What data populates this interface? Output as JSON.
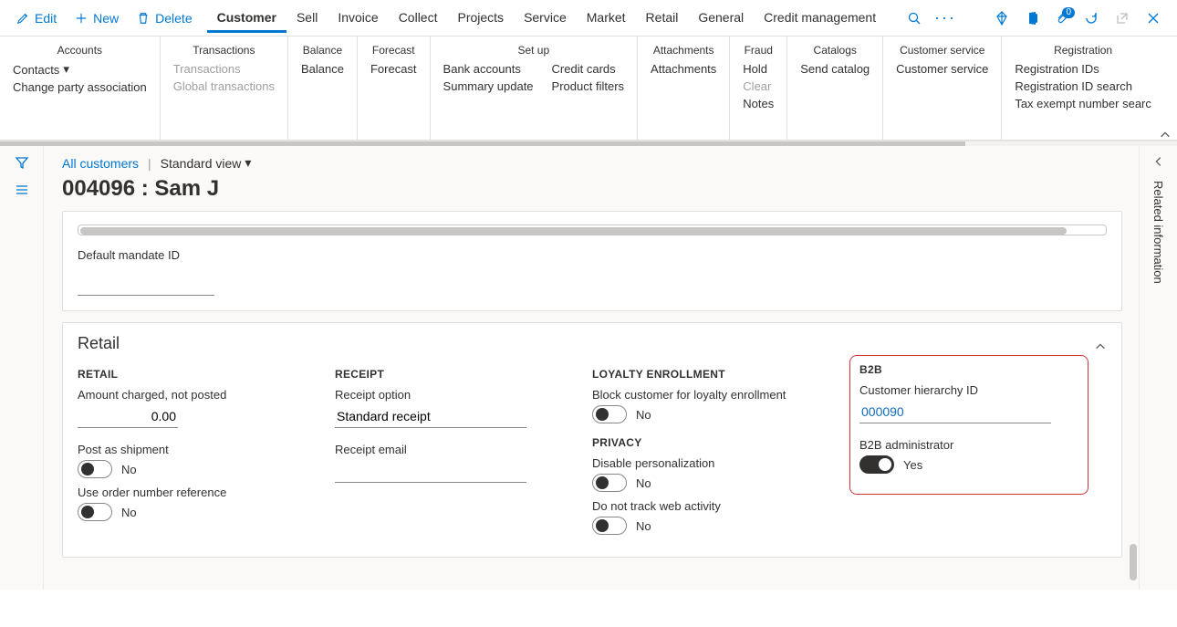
{
  "topbar": {
    "edit": "Edit",
    "new": "New",
    "delete": "Delete",
    "tabs": [
      "Customer",
      "Sell",
      "Invoice",
      "Collect",
      "Projects",
      "Service",
      "Market",
      "Retail",
      "General",
      "Credit management"
    ],
    "active_tab_index": 0,
    "notifications_count": "0"
  },
  "ribbon": {
    "groups": [
      {
        "title": "Accounts",
        "cols": [
          [
            "Contacts",
            "Change party association"
          ]
        ]
      },
      {
        "title": "Transactions",
        "cols": [
          [
            "Transactions",
            "Global transactions"
          ]
        ],
        "disabled": true
      },
      {
        "title": "Balance",
        "cols": [
          [
            "Balance"
          ]
        ]
      },
      {
        "title": "Forecast",
        "cols": [
          [
            "Forecast"
          ]
        ]
      },
      {
        "title": "Set up",
        "cols": [
          [
            "Bank accounts",
            "Summary update"
          ],
          [
            "Credit cards",
            "Product filters"
          ]
        ]
      },
      {
        "title": "Attachments",
        "cols": [
          [
            "Attachments"
          ]
        ]
      },
      {
        "title": "Fraud",
        "cols": [
          [
            "Hold",
            "Clear",
            "Notes"
          ]
        ],
        "disabled_items": [
          "Clear"
        ]
      },
      {
        "title": "Catalogs",
        "cols": [
          [
            "Send catalog"
          ]
        ]
      },
      {
        "title": "Customer service",
        "cols": [
          [
            "Customer service"
          ]
        ]
      },
      {
        "title": "Registration",
        "cols": [
          [
            "Registration IDs",
            "Registration ID search",
            "Tax exempt number searc"
          ]
        ]
      }
    ]
  },
  "breadcrumb": {
    "link": "All customers",
    "view": "Standard view"
  },
  "page_title": "004096 : Sam J",
  "mandate": {
    "label": "Default mandate ID",
    "value": ""
  },
  "retail": {
    "section_title": "Retail",
    "retail_group": "RETAIL",
    "amount_label": "Amount charged, not posted",
    "amount_value": "0.00",
    "post_as_shipment_label": "Post as shipment",
    "post_as_shipment_value": "No",
    "use_order_ref_label": "Use order number reference",
    "use_order_ref_value": "No",
    "receipt_group": "RECEIPT",
    "receipt_option_label": "Receipt option",
    "receipt_option_value": "Standard receipt",
    "receipt_email_label": "Receipt email",
    "receipt_email_value": "",
    "loyalty_group": "LOYALTY ENROLLMENT",
    "block_loyalty_label": "Block customer for loyalty enrollment",
    "block_loyalty_value": "No",
    "privacy_group": "PRIVACY",
    "disable_personalization_label": "Disable personalization",
    "disable_personalization_value": "No",
    "do_not_track_label": "Do not track web activity",
    "do_not_track_value": "No",
    "b2b_group": "B2B",
    "hierarchy_label": "Customer hierarchy ID",
    "hierarchy_value": "000090",
    "b2b_admin_label": "B2B administrator",
    "b2b_admin_value": "Yes"
  },
  "right_rail": {
    "label": "Related information"
  }
}
